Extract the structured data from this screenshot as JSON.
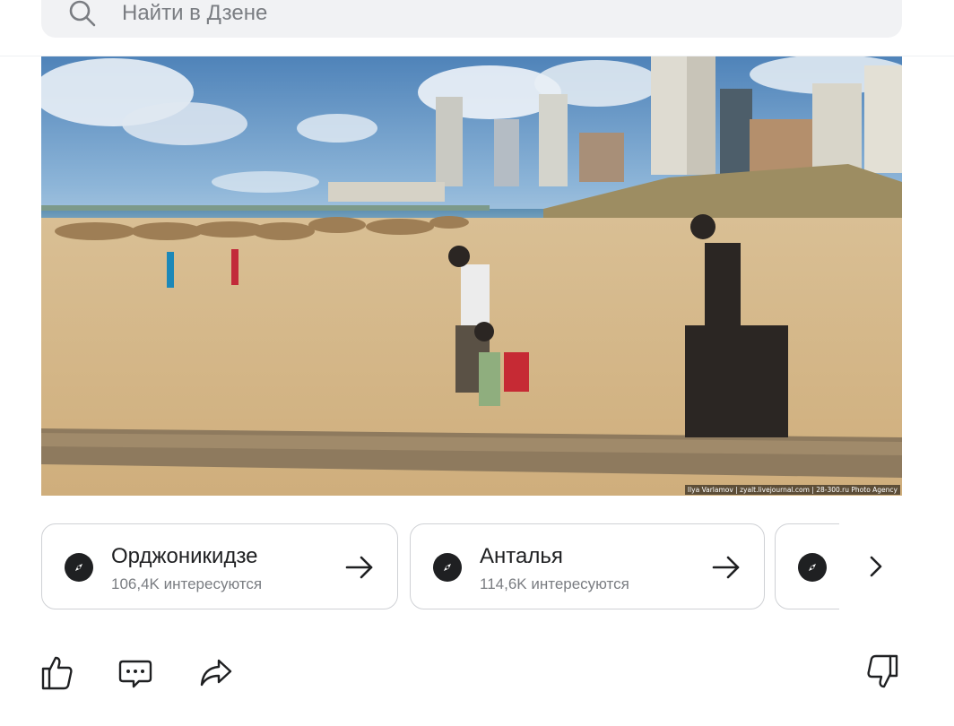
{
  "search": {
    "placeholder": "Найти в Дзене"
  },
  "photo": {
    "credit": "Ilya Varlamov | zyalt.livejournal.com | 28-300.ru Photo Agency",
    "description_icon": "beach-photo"
  },
  "chips": [
    {
      "title": "Орджоникидзе",
      "subtitle": "106,4K интересуются",
      "icon": "compass-icon"
    },
    {
      "title": "Анталья",
      "subtitle": "114,6K интересуются",
      "icon": "compass-icon"
    },
    {
      "title": "",
      "subtitle": "",
      "icon": "compass-icon"
    }
  ],
  "actions": {
    "like": "thumbs-up-icon",
    "comment": "comment-icon",
    "share": "share-icon",
    "dislike": "thumbs-down-icon"
  },
  "colors": {
    "search_bg": "#f1f2f4",
    "chip_border": "#cfd1d5",
    "icon_dark": "#1f2022",
    "muted_text": "#7a7d82"
  }
}
